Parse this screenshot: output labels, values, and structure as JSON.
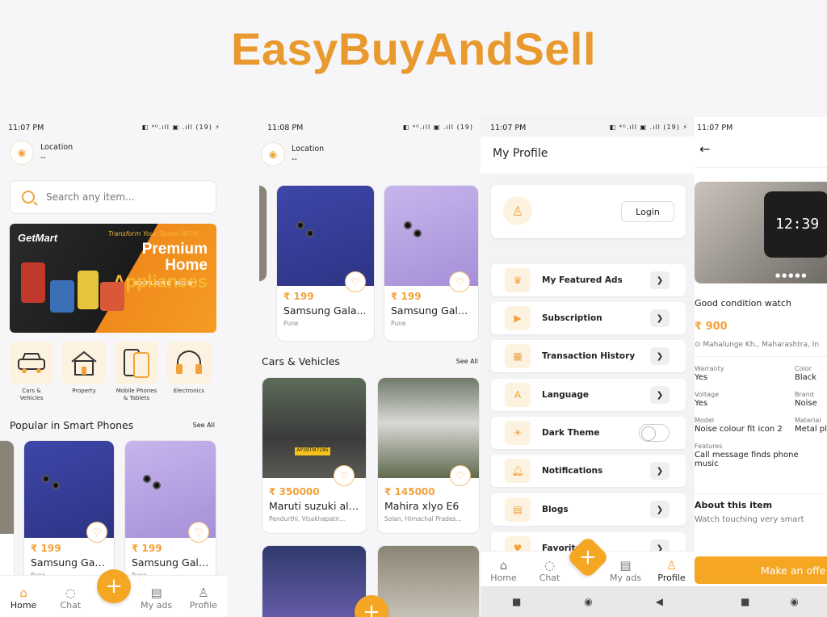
{
  "app_title": "EasyBuyAndSell",
  "colors": {
    "accent": "#f5a623",
    "title": "#e89a2e"
  },
  "screen1": {
    "status_time": "11:07 PM",
    "status_icons": "◧ ⁴ᴳ.ıll ▣ .ıll (19) ⚡",
    "location_label": "Location",
    "location_value": "--",
    "search_placeholder": "Search any item...",
    "banner": {
      "logo": "GetMart",
      "line1": "Transform Your Space WITH",
      "line2": "Premium Home",
      "line3": "Appliances",
      "cta": "EXPLORE NOW!"
    },
    "categories": [
      {
        "label": "Cars & Vehicles",
        "icon": "car-icon"
      },
      {
        "label": "Property",
        "icon": "house-icon"
      },
      {
        "label": "Mobile Phones & Tablets",
        "icon": "phone-icon"
      },
      {
        "label": "Electronics",
        "icon": "headphones-icon"
      }
    ],
    "section_title": "Popular in Smart Phones",
    "see_all": "See All",
    "products": [
      {
        "price": "₹ 199",
        "name": "Samsung Gala...",
        "location": "Pune"
      },
      {
        "price": "₹ 199",
        "name": "Samsung Gala...",
        "location": "Pune"
      }
    ],
    "nav": [
      "Home",
      "Chat",
      "My ads",
      "Profile"
    ]
  },
  "screen2": {
    "status_time": "11:08 PM",
    "status_icons": "◧ ⁴ᴳ.ıll ▣ .ıll (19)",
    "location_label": "Location",
    "location_value": "--",
    "phones": [
      {
        "price": "₹ 199",
        "name": "Samsung Gala...",
        "location": "Pune"
      },
      {
        "price": "₹ 199",
        "name": "Samsung Gala...",
        "location": "Pune"
      }
    ],
    "section_title": "Cars & Vehicles",
    "see_all": "See All",
    "cars": [
      {
        "price": "₹ 350000",
        "name": "Maruti suzuki alt...",
        "location": "Pendurthi, Visakhapatn..."
      },
      {
        "price": "₹ 145000",
        "name": "Mahira xlyo E6",
        "location": "Solan, Himachal Prades..."
      }
    ]
  },
  "screen3": {
    "status_time": "11:07 PM",
    "status_icons": "◧ ⁴ᴳ.ıll ▣ .ıll (19) ⚡",
    "header": "My Profile",
    "login_label": "Login",
    "menu": [
      {
        "label": "My Featured Ads",
        "icon": "crown-icon"
      },
      {
        "label": "Subscription",
        "icon": "subscription-icon"
      },
      {
        "label": "Transaction History",
        "icon": "receipt-icon"
      },
      {
        "label": "Language",
        "icon": "language-icon"
      },
      {
        "label": "Dark Theme",
        "icon": "sun-icon"
      },
      {
        "label": "Notifications",
        "icon": "bell-icon"
      },
      {
        "label": "Blogs",
        "icon": "blog-icon"
      },
      {
        "label": "Favorites",
        "icon": "heart-icon"
      }
    ],
    "nav": [
      "Home",
      "Chat",
      "My ads",
      "Profile"
    ]
  },
  "screen4": {
    "status_time": "11:07 PM",
    "watch_time": "12:39",
    "title": "Good condition watch",
    "price": "₹ 900",
    "location": "Mahalunge Kh., Maharashtra, In",
    "specs": [
      {
        "k": "Warranty",
        "v": "Yes",
        "k2": "Color",
        "v2": "Black"
      },
      {
        "k": "Voltage",
        "v": "Yes",
        "k2": "Brand",
        "v2": "Noise"
      },
      {
        "k": "Model",
        "v": "Noise colour fit icon 2",
        "k2": "Material",
        "v2": "Metal pla"
      }
    ],
    "features_label": "Features",
    "features_value": "Call message finds phone music",
    "about_title": "About this item",
    "about_text": "Watch touching very smart",
    "offer_button": "Make an offe"
  }
}
